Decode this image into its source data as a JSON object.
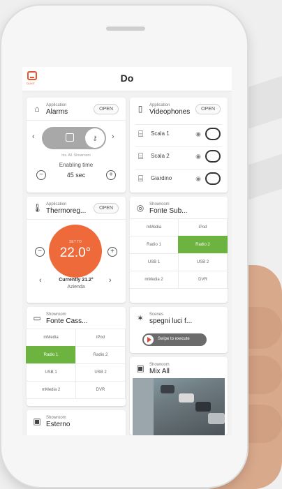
{
  "header": {
    "title": "Do",
    "logo_text": "DUVIT"
  },
  "alarms": {
    "category": "Application",
    "name": "Alarms",
    "open_label": "OPEN",
    "zone_label": "Ins. All. Showroom",
    "timer_label": "Enabling time",
    "timer_value": "45 sec"
  },
  "videophones": {
    "category": "Application",
    "name": "Videophones",
    "open_label": "OPEN",
    "entries": [
      {
        "label": "Scala 1"
      },
      {
        "label": "Scala 2"
      },
      {
        "label": "Giardino"
      }
    ]
  },
  "thermo": {
    "category": "Application",
    "name": "Thermoreg...",
    "open_label": "OPEN",
    "set_label": "SET TO",
    "set_value": "22.0°",
    "current_label": "Currently 21.2°",
    "zone": "Azienda",
    "accent": "#ef6a3a"
  },
  "fonte_sub": {
    "category": "Showroom",
    "name": "Fonte Sub...",
    "sources": [
      "mMedia",
      "iPod",
      "Radio 1",
      "Radio 2",
      "USB 1",
      "USB 2",
      "mMedia 2",
      "DVR"
    ],
    "active": "Radio 2"
  },
  "fonte_cass": {
    "category": "Showroom",
    "name": "Fonte Cass...",
    "sources": [
      "mMedia",
      "iPod",
      "Radio 1",
      "Radio 2",
      "USB 1",
      "USB 2",
      "mMedia 2",
      "DVR"
    ],
    "active": "Radio 1"
  },
  "scene": {
    "category": "Scenes",
    "name": "spegni luci f...",
    "swipe_label": "Swipe to execute"
  },
  "mix": {
    "category": "Showroom",
    "name": "Mix All"
  },
  "esterno": {
    "category": "Showroom",
    "name": "Esterno"
  },
  "colors": {
    "active_source": "#6db33f",
    "brand": "#e4572e"
  }
}
